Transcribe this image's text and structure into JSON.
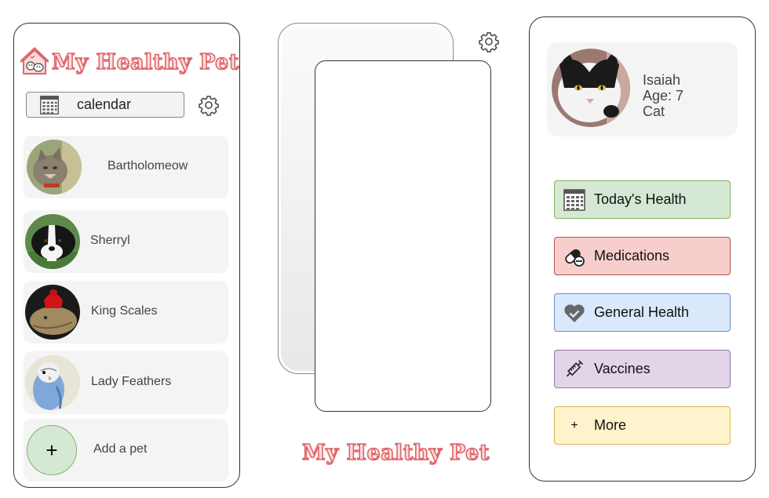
{
  "app": {
    "name": "My Healthy Pet"
  },
  "left": {
    "calendar_label": "calendar",
    "pets": [
      {
        "name": "Bartholomeow"
      },
      {
        "name": "Sherryl"
      },
      {
        "name": "King Scales"
      },
      {
        "name": "Lady Feathers"
      }
    ],
    "add_label": "Add a pet",
    "add_symbol": "+"
  },
  "right": {
    "profile": {
      "name": "Isaiah",
      "age": "Age: 7",
      "species": "Cat"
    },
    "menu": [
      {
        "label": "Today's Health",
        "icon": "calendar-icon",
        "color": "#d5e8d4"
      },
      {
        "label": "Medications",
        "icon": "pill-icon",
        "color": "#f8cecc"
      },
      {
        "label": "General Health",
        "icon": "heart-check-icon",
        "color": "#dae8fc"
      },
      {
        "label": "Vaccines",
        "icon": "syringe-icon",
        "color": "#e1d5e7"
      },
      {
        "label": "More",
        "icon": "plus-icon",
        "color": "#fff2cc"
      }
    ],
    "more_symbol": "+"
  },
  "colors": {
    "logo_fill": "#fbdcdc",
    "logo_stroke": "#e0666b"
  }
}
